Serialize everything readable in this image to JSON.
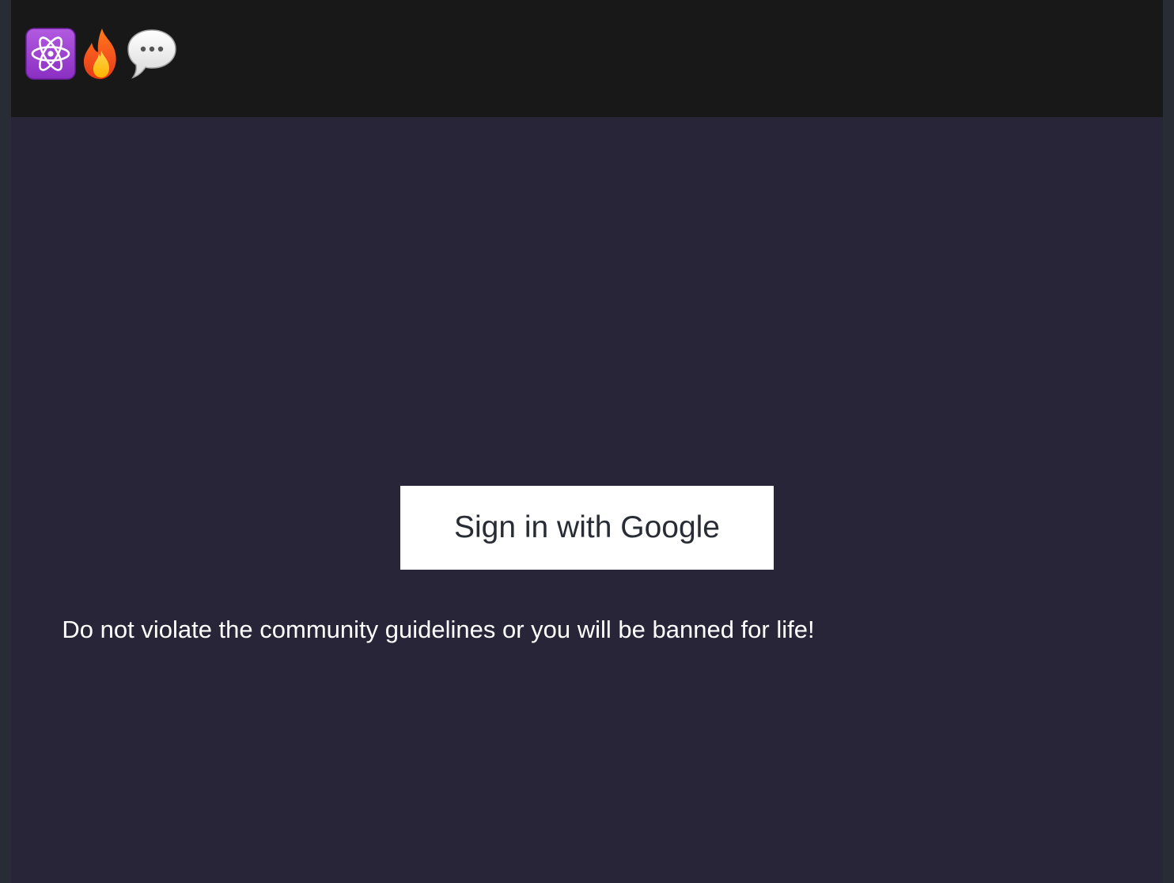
{
  "header": {
    "logo_icons": [
      "atom-symbol-icon",
      "fire-icon",
      "speech-balloon-icon"
    ]
  },
  "main": {
    "signin_label": "Sign in with Google",
    "guidelines_text": "Do not violate the community guidelines or you will be banned for life!"
  },
  "colors": {
    "page_background": "#282538",
    "header_background": "#181818",
    "button_background": "#ffffff",
    "button_text": "#282c34",
    "text": "#ffffff",
    "atom_tile": "#9b3fcf",
    "flame_outer": "#f4511e",
    "flame_inner": "#ffc107"
  }
}
